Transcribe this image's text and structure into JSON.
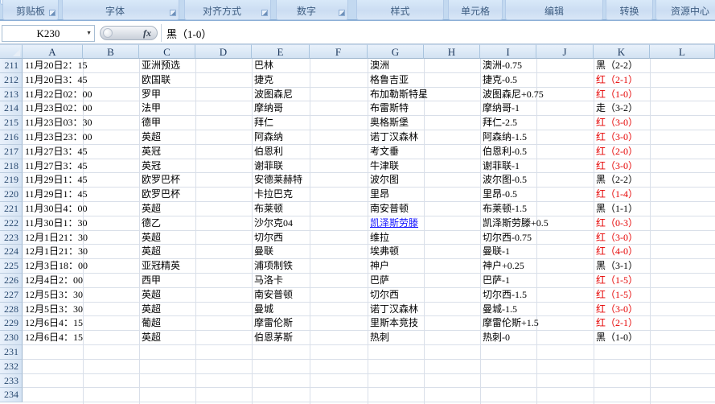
{
  "ribbon": {
    "groups": [
      {
        "label": "剪贴板"
      },
      {
        "label": "字体"
      },
      {
        "label": "对齐方式"
      },
      {
        "label": "数字"
      },
      {
        "label": "样式"
      },
      {
        "label": "单元格"
      },
      {
        "label": "编辑"
      },
      {
        "label": "转换"
      },
      {
        "label": "资源中心"
      }
    ]
  },
  "formula_bar": {
    "name_box": "K230",
    "fx_label": "fx",
    "content": "黑（1-0）"
  },
  "sheet": {
    "columns": [
      "A",
      "B",
      "C",
      "D",
      "E",
      "F",
      "G",
      "H",
      "I",
      "J",
      "K",
      "L"
    ],
    "rows": [
      {
        "n": 211,
        "date": "11月20日2：15",
        "league": "亚洲预选",
        "home": "巴林",
        "away": "澳洲",
        "handicap": "澳洲-0.75",
        "result": "黑（2-2）",
        "result_color": "black",
        "away_link": false
      },
      {
        "n": 212,
        "date": "11月20日3：45",
        "league": "欧国联",
        "home": "捷克",
        "away": "格鲁吉亚",
        "handicap": "捷克-0.5",
        "result": "红（2-1）",
        "result_color": "red",
        "away_link": false
      },
      {
        "n": 213,
        "date": "11月22日02：00",
        "league": "罗甲",
        "home": "波图森尼",
        "away": "布加勒斯特星",
        "handicap": "波图森尼+0.75",
        "result": "红（1-0）",
        "result_color": "red",
        "away_link": false
      },
      {
        "n": 214,
        "date": "11月23日02：00",
        "league": "法甲",
        "home": "摩纳哥",
        "away": "布雷斯特",
        "handicap": "摩纳哥-1",
        "result": "走（3-2）",
        "result_color": "black",
        "away_link": false
      },
      {
        "n": 215,
        "date": "11月23日03：30",
        "league": "德甲",
        "home": "拜仁",
        "away": "奥格斯堡",
        "handicap": "拜仁-2.5",
        "result": "红（3-0）",
        "result_color": "red",
        "away_link": false
      },
      {
        "n": 216,
        "date": "11月23日23：00",
        "league": "英超",
        "home": "阿森纳",
        "away": "诺丁汉森林",
        "handicap": "阿森纳-1.5",
        "result": "红（3-0）",
        "result_color": "red",
        "away_link": false
      },
      {
        "n": 217,
        "date": "11月27日3：45",
        "league": "英冠",
        "home": "伯恩利",
        "away": "考文垂",
        "handicap": "伯恩利-0.5",
        "result": "红（2-0）",
        "result_color": "red",
        "away_link": false
      },
      {
        "n": 218,
        "date": "11月27日3：45",
        "league": "英冠",
        "home": "谢菲联",
        "away": "牛津联",
        "handicap": "谢菲联-1",
        "result": "红（3-0）",
        "result_color": "red",
        "away_link": false
      },
      {
        "n": 219,
        "date": "11月29日1：45",
        "league": "欧罗巴杯",
        "home": "安德莱赫特",
        "away": "波尔图",
        "handicap": "波尔图-0.5",
        "result": "黑（2-2）",
        "result_color": "black",
        "away_link": false
      },
      {
        "n": 220,
        "date": "11月29日1：45",
        "league": "欧罗巴杯",
        "home": "卡拉巴克",
        "away": "里昂",
        "handicap": "里昂-0.5",
        "result": "红（1-4）",
        "result_color": "red",
        "away_link": false
      },
      {
        "n": 221,
        "date": "11月30日4：00",
        "league": "英超",
        "home": "布莱顿",
        "away": "南安普顿",
        "handicap": "布莱顿-1.5",
        "result": "黑（1-1）",
        "result_color": "black",
        "away_link": false
      },
      {
        "n": 222,
        "date": "11月30日1：30",
        "league": "德乙",
        "home": "沙尔克04",
        "away": "凯泽斯劳滕",
        "handicap": "凯泽斯劳滕+0.5",
        "result": "红（0-3）",
        "result_color": "red",
        "away_link": true
      },
      {
        "n": 223,
        "date": "12月1日21：30",
        "league": "英超",
        "home": "切尔西",
        "away": "维拉",
        "handicap": "切尔西-0.75",
        "result": "红（3-0）",
        "result_color": "red",
        "away_link": false
      },
      {
        "n": 224,
        "date": "12月1日21：30",
        "league": "英超",
        "home": "曼联",
        "away": "埃弗顿",
        "handicap": "曼联-1",
        "result": "红（4-0）",
        "result_color": "red",
        "away_link": false
      },
      {
        "n": 225,
        "date": "12月3日18：00",
        "league": "亚冠精英",
        "home": "浦项制铁",
        "away": "神户",
        "handicap": "神户+0.25",
        "result": "黑（3-1）",
        "result_color": "black",
        "away_link": false
      },
      {
        "n": 226,
        "date": "12月4日2：00",
        "league": "西甲",
        "home": "马洛卡",
        "away": "巴萨",
        "handicap": "巴萨-1",
        "result": "红（1-5）",
        "result_color": "red",
        "away_link": false
      },
      {
        "n": 227,
        "date": "12月5日3：30",
        "league": "英超",
        "home": "南安普顿",
        "away": "切尔西",
        "handicap": "切尔西-1.5",
        "result": "红（1-5）",
        "result_color": "red",
        "away_link": false
      },
      {
        "n": 228,
        "date": "12月5日3：30",
        "league": "英超",
        "home": "曼城",
        "away": "诺丁汉森林",
        "handicap": "曼城-1.5",
        "result": "红（3-0）",
        "result_color": "red",
        "away_link": false
      },
      {
        "n": 229,
        "date": "12月6日4：15",
        "league": "葡超",
        "home": "摩雷伦斯",
        "away": "里斯本竞技",
        "handicap": "摩雷伦斯+1.5",
        "result": "红（2-1）",
        "result_color": "red",
        "away_link": false
      },
      {
        "n": 230,
        "date": "12月6日4：15",
        "league": "英超",
        "home": "伯恩茅斯",
        "away": "热刺",
        "handicap": "热刺-0",
        "result": "黑（1-0）",
        "result_color": "black",
        "away_link": false
      }
    ],
    "empty_row_numbers": [
      231,
      232,
      233,
      234
    ]
  },
  "colors": {
    "result_red": "#E50000",
    "link_blue": "#1414FF"
  }
}
